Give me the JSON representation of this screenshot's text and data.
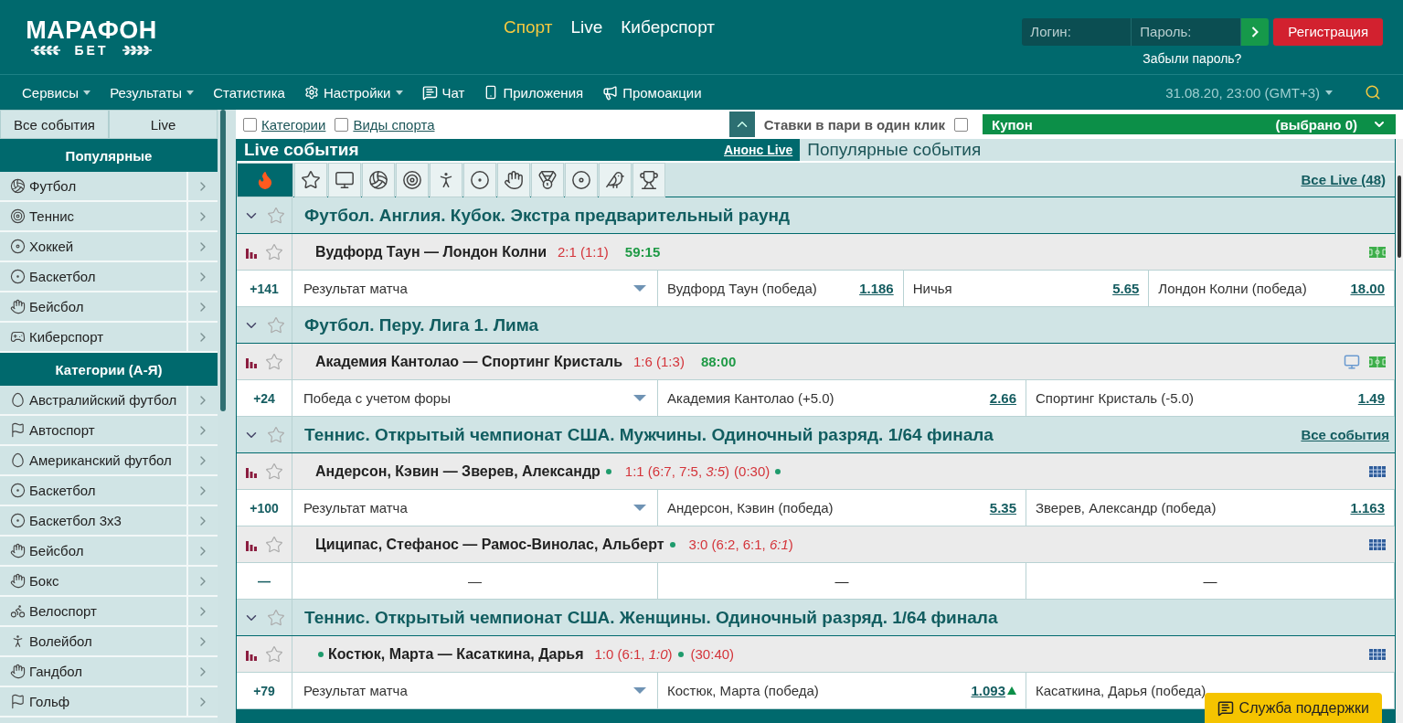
{
  "logo": {
    "title": "МАРАФОН",
    "subtitle": "БЕТ"
  },
  "nav": [
    {
      "label": "Спорт",
      "selected": true
    },
    {
      "label": "Live",
      "selected": false
    },
    {
      "label": "Киберспорт",
      "selected": false
    }
  ],
  "login": {
    "login_placeholder": "Логин:",
    "password_placeholder": "Пароль:",
    "register": "Регистрация",
    "forgot": "Забыли пароль?"
  },
  "menu": [
    {
      "label": "Сервисы",
      "kind": "plain",
      "dropdown": true
    },
    {
      "label": "Результаты",
      "kind": "plain",
      "dropdown": true
    },
    {
      "label": "Статистика",
      "kind": "plain",
      "dropdown": false
    },
    {
      "label": "Настройки",
      "kind": "settings",
      "dropdown": true
    },
    {
      "label": "Чат",
      "kind": "chat",
      "dropdown": false
    },
    {
      "label": "Приложения",
      "kind": "phone",
      "dropdown": false
    },
    {
      "label": "Промоакции",
      "kind": "promo",
      "dropdown": false
    }
  ],
  "datetime": "31.08.20, 23:00 (GMT+3)",
  "sidebar": {
    "tabs": [
      {
        "label": "Все события",
        "selected": false
      },
      {
        "label": "Live",
        "selected": false
      }
    ],
    "sections": [
      {
        "title": "Популярные",
        "items": [
          "Футбол",
          "Теннис",
          "Хоккей",
          "Баскетбол",
          "Бейсбол",
          "Киберспорт"
        ]
      },
      {
        "title": "Категории (А-Я)",
        "items": [
          "Австралийский футбол",
          "Автоспорт",
          "Американский футбол",
          "Баскетбол",
          "Баскетбол 3x3",
          "Бейсбол",
          "Бокс",
          "Велоспорт",
          "Волейбол",
          "Гандбол",
          "Гольф"
        ]
      }
    ]
  },
  "filters": [
    {
      "label": "Категории",
      "checked": false
    },
    {
      "label": "Виды спорта",
      "checked": false
    }
  ],
  "one_click": {
    "label": "Ставки в пари в один клик",
    "checked": false
  },
  "coupon": {
    "title": "Купон",
    "count": "(выбрано 0)"
  },
  "live_tabs": [
    {
      "label": "Live события",
      "kind": "tab",
      "selected": true
    },
    {
      "label": "Анонс Live",
      "kind": "link",
      "selected": false
    },
    {
      "label": "Популярные события",
      "kind": "tab",
      "selected": false
    }
  ],
  "sport_filters": [
    {
      "selected": true
    },
    {
      "selected": false
    },
    {
      "selected": false
    },
    {
      "selected": false
    },
    {
      "selected": false
    },
    {
      "selected": false
    },
    {
      "selected": false
    },
    {
      "selected": false
    },
    {
      "selected": false
    },
    {
      "selected": false
    },
    {
      "selected": false
    },
    {
      "selected": false
    }
  ],
  "all_live": "Все Live (48)",
  "groups": [
    {
      "title": "Футбол. Англия. Кубок. Экстра предварительный раунд",
      "events": [
        {
          "teams": "Вудфорд Таун — Лондон Колни",
          "score": "2:1 (1:1)",
          "time": "59:15",
          "kind": "football",
          "broadcast": false,
          "market": {
            "kind": "odds",
            "count": "+141",
            "name": "Результат матча",
            "outcomes": [
              {
                "name": "Вудфорд Таун (победа)",
                "odds": "1.186"
              },
              {
                "name": "Ничья",
                "odds": "5.65"
              },
              {
                "name": "Лондон Колни (победа)",
                "odds": "18.00"
              }
            ]
          }
        }
      ]
    },
    {
      "title": "Футбол. Перу. Лига 1. Лима",
      "events": [
        {
          "teams": "Академия Кантолао — Спортинг Кристаль",
          "score": "1:6 (1:3)",
          "time": "88:00",
          "kind": "football",
          "broadcast": true,
          "market": {
            "kind": "odds",
            "count": "+24",
            "name": "Победа с учетом форы",
            "outcomes": [
              {
                "name": "Академия Кантолао (+5.0)",
                "odds": "2.66"
              },
              {
                "name": "Спортинг Кристаль (-5.0)",
                "odds": "1.49"
              }
            ]
          }
        }
      ]
    },
    {
      "title": "Теннис. Открытый чемпионат США. Мужчины. Одиночный разряд. 1/64 финала",
      "link": "Все события",
      "events": [
        {
          "teams": "Андерсон, Кэвин — Зверев, Александр",
          "home_serving": false,
          "away_serving": true,
          "score": "1:1 (6:7, 7:5, *3:5*)",
          "game": "(0:30)",
          "kind": "tennis",
          "broadcast": false,
          "market": {
            "kind": "odds",
            "count": "+100",
            "name": "Результат матча",
            "outcomes": [
              {
                "name": "Андерсон, Кэвин (победа)",
                "odds": "5.35"
              },
              {
                "name": "Зверев, Александр (победа)",
                "odds": "1.163"
              }
            ]
          }
        },
        {
          "teams": "Циципас, Стефанос — Рамос-Винолас, Альберт",
          "home_serving": false,
          "away_serving": true,
          "score": "3:0 (6:2, 6:1, *6:1*)",
          "kind": "tennis",
          "broadcast": false,
          "market": {
            "kind": "empty",
            "count": "—",
            "name": "—",
            "outcomes": [
              {
                "odds": "—"
              },
              {
                "odds": "—"
              }
            ]
          }
        }
      ]
    },
    {
      "title": "Теннис. Открытый чемпионат США. Женщины. Одиночный разряд. 1/64 финала",
      "events": [
        {
          "teams": "Костюк, Марта — Касаткина, Дарья",
          "home_serving": true,
          "away_serving": false,
          "score": "1:0 (6:1, *1:0*)",
          "game": "(30:40)",
          "kind": "tennis",
          "broadcast": false,
          "market": {
            "kind": "odds",
            "count": "+79",
            "name": "Результат матча",
            "outcomes": [
              {
                "name": "Костюк, Марта (победа)",
                "odds": "1.093",
                "rising": true
              },
              {
                "name": "Касаткина, Дарья (победа)"
              }
            ]
          }
        }
      ]
    }
  ],
  "support": "Служба поддержки"
}
